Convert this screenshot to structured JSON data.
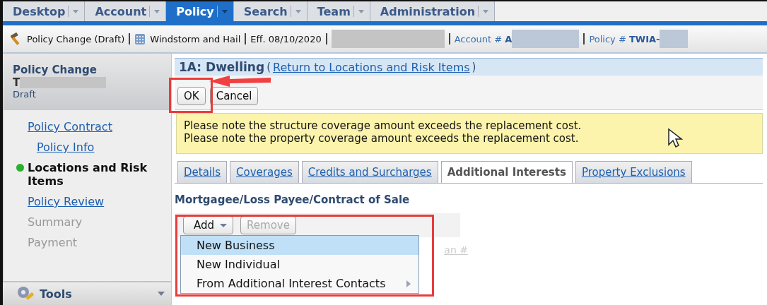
{
  "top_tabs": [
    {
      "label": "Desktop",
      "selected": false
    },
    {
      "label": "Account",
      "selected": false
    },
    {
      "label": "Policy",
      "selected": true
    },
    {
      "label": "Search",
      "selected": false
    },
    {
      "label": "Team",
      "selected": false
    },
    {
      "label": "Administration",
      "selected": false
    }
  ],
  "info_bar": {
    "job": "Policy Change (Draft)",
    "product": "Windstorm and Hail",
    "effective": "Eff. 08/10/2020",
    "account_label": "Account #",
    "account_value": "A",
    "policy_label": "Policy #",
    "policy_value": "TWIA-"
  },
  "sidebar": {
    "title": "Policy Change",
    "number": "T",
    "status": "Draft",
    "items": [
      {
        "label": "Policy Contract",
        "kind": "link",
        "selected": false,
        "children": [
          {
            "label": "Policy Info",
            "kind": "link",
            "selected": false
          }
        ]
      },
      {
        "label": "Locations and Risk Items",
        "kind": "link",
        "selected": true
      },
      {
        "label": "Policy Review",
        "kind": "link",
        "selected": false
      },
      {
        "label": "Summary",
        "kind": "disabled",
        "selected": false
      },
      {
        "label": "Payment",
        "kind": "disabled",
        "selected": false
      }
    ],
    "tools": "Tools"
  },
  "page": {
    "title": "1A: Dwelling",
    "return_open": "(",
    "return_link": "Return to Locations and Risk Items",
    "return_close": ")",
    "buttons": [
      "OK",
      "Cancel"
    ],
    "messages": [
      "Please note the structure coverage amount exceeds the replacement cost.",
      "Please note the property coverage amount exceeds the replacement cost."
    ],
    "tabs": [
      {
        "label": "Details",
        "selected": false
      },
      {
        "label": "Coverages",
        "selected": false
      },
      {
        "label": "Credits and Surcharges",
        "selected": false
      },
      {
        "label": "Additional Interests",
        "selected": true
      },
      {
        "label": "Property Exclusions",
        "selected": false
      }
    ],
    "section_title": "Mortgagee/Loss Payee/Contract of Sale",
    "add_button": "Add",
    "remove_button": {
      "label": "Remove",
      "disabled": true
    },
    "column_fragment": "an #",
    "menu": [
      {
        "label": "New Business",
        "selected": true,
        "submenu": false
      },
      {
        "label": "New Individual",
        "selected": false,
        "submenu": false
      },
      {
        "label": "From Additional Interest Contacts",
        "selected": false,
        "submenu": true
      }
    ]
  }
}
